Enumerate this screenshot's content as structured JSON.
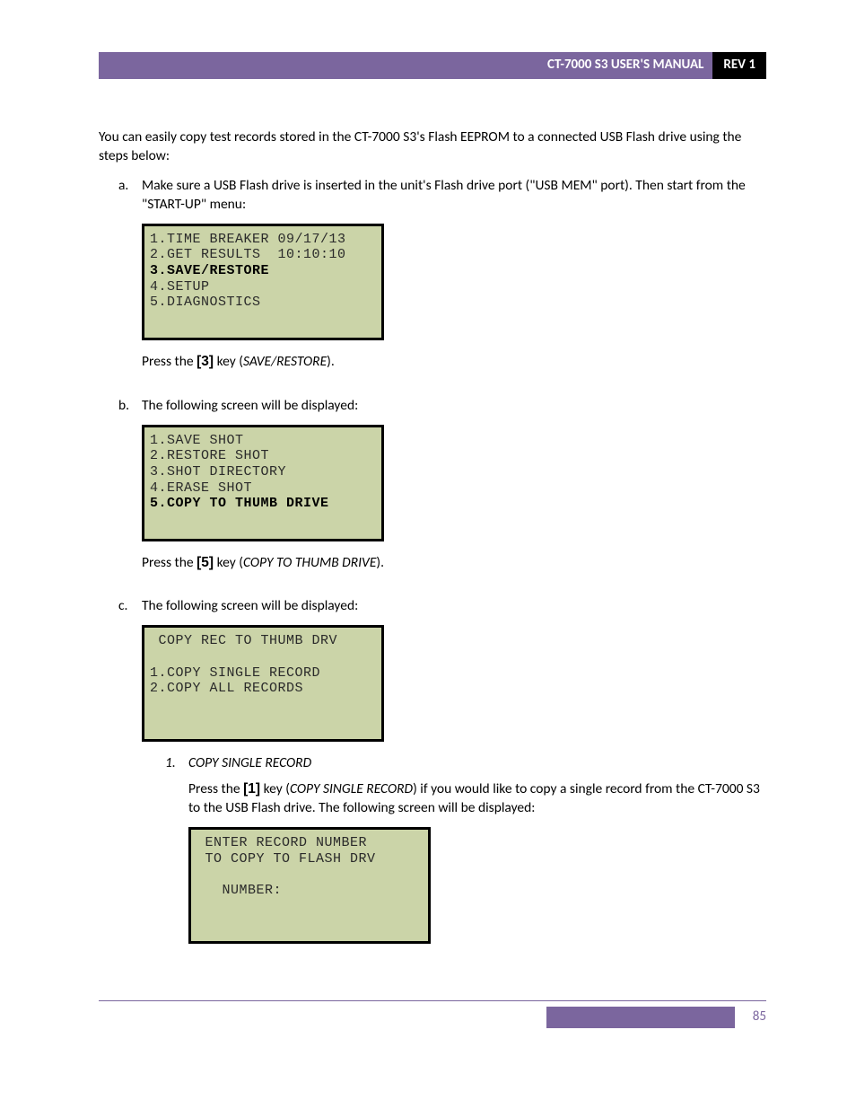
{
  "header": {
    "title": "CT-7000 S3 USER'S MANUAL",
    "rev": "REV 1"
  },
  "intro": "You can easily copy test records stored in the CT-7000 S3's Flash EEPROM to a connected USB Flash drive using the steps below:",
  "steps": {
    "a": {
      "label": "a.",
      "text": "Make sure a USB Flash drive is inserted in the unit's Flash drive port (\"USB MEM\" port). Then start from the \"START-UP\" menu:",
      "lcd": {
        "l1": "1.TIME BREAKER 09/17/13",
        "l2": "2.GET RESULTS  10:10:10",
        "l3": "3.SAVE/RESTORE",
        "l4": "4.SETUP",
        "l5": "5.DIAGNOSTICS"
      },
      "press_pre": "Press the ",
      "press_key": "[3]",
      "press_post": " key (",
      "press_ital": "SAVE/RESTORE",
      "press_end": ")."
    },
    "b": {
      "label": "b.",
      "text": "The following screen will be displayed:",
      "lcd": {
        "l1": "1.SAVE SHOT",
        "l2": "2.RESTORE SHOT",
        "l3": "3.SHOT DIRECTORY",
        "l4": "4.ERASE SHOT",
        "l5": "5.COPY TO THUMB DRIVE"
      },
      "press_pre": "Press the ",
      "press_key": "[5]",
      "press_post": " key (",
      "press_ital": "COPY TO THUMB DRIVE",
      "press_end": ")."
    },
    "c": {
      "label": "c.",
      "text": "The following screen will be displayed:",
      "lcd": {
        "l1": " COPY REC TO THUMB DRV",
        "l2": "",
        "l3": "1.COPY SINGLE RECORD",
        "l4": "2.COPY ALL RECORDS"
      },
      "sub1": {
        "num": "1.",
        "title": "COPY SINGLE RECORD",
        "body_pre": "Press the ",
        "body_key": "[1]",
        "body_post": " key (",
        "body_ital": "COPY SINGLE RECORD",
        "body_after": ") if you would like to copy a single record from the CT-7000 S3 to the USB Flash drive. The following screen will be displayed:",
        "lcd": {
          "l1": " ENTER RECORD NUMBER",
          "l2": " TO COPY TO FLASH DRV",
          "l3": "",
          "l4": "   NUMBER:"
        }
      }
    }
  },
  "footer": {
    "page": "85"
  }
}
